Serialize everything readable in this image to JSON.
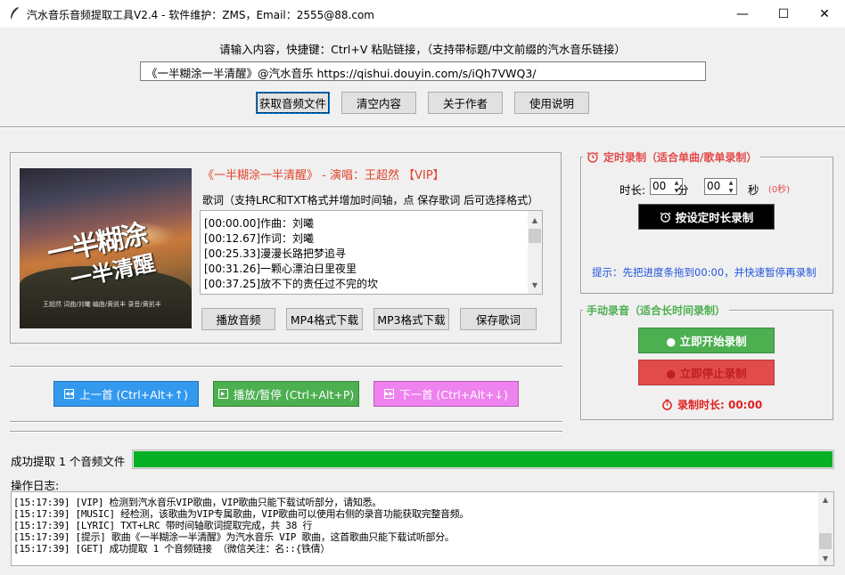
{
  "window": {
    "title": "汽水音乐音频提取工具V2.4 - 软件维护：ZMS，Email：2555@88.com",
    "minimize": "—",
    "maximize": "☐",
    "close": "✕"
  },
  "input": {
    "hint": "请输入内容，快捷键：Ctrl+V 粘贴链接，（支持带标题/中文前缀的汽水音乐链接）",
    "value": "《一半糊涂一半清醒》@汽水音乐 https://qishui.douyin.com/s/iQh7VWQ3/"
  },
  "top_buttons": {
    "fetch": "获取音频文件",
    "clear": "清空内容",
    "about": "关于作者",
    "help": "使用说明"
  },
  "song": {
    "title_line": "《一半糊涂一半清醒》 - 演唱：王超然 【VIP】",
    "cover_art_text": "一半糊涂一半清醒",
    "cover_credit": "王超然     词曲/刘曦   编曲/黄凯丰   录音/黄凯丰",
    "lyrics_label": "歌词（支持LRC和TXT格式并增加时间轴，点 保存歌词 后可选择格式）",
    "lyrics": [
      "[00:00.00]作曲：刘曦",
      "[00:12.67]作词：刘曦",
      "[00:25.33]漫漫长路把梦追寻",
      "[00:31.26]一颗心漂泊日里夜里",
      "[00:37.25]放不下的责任过不完的坎"
    ],
    "buttons": {
      "play": "播放音频",
      "mp4": "MP4格式下载",
      "mp3": "MP3格式下载",
      "save_lyrics": "保存歌词"
    }
  },
  "nav": {
    "prev": "上一首 (Ctrl+Alt+↑)",
    "play_pause": "播放/暂停 (Ctrl+Alt+P)",
    "next": "下一首 (Ctrl+Alt+↓)",
    "colors": {
      "prev": "#3399ee",
      "play": "#4caf50",
      "next": "#ee82ee"
    }
  },
  "timer_record": {
    "title": "定时录制（适合单曲/歌单录制）",
    "duration_label": "时长:",
    "minutes_value": "00",
    "minutes_unit": "分",
    "seconds_value": "00",
    "seconds_unit": "秒",
    "seconds_total": "(0秒)",
    "record_button": "按设定时长录制",
    "tip": "提示：先把进度条拖到00:00，并快速暂停再录制"
  },
  "manual_record": {
    "title": "手动录音（适合长时间录制）",
    "start_button": "● 立即开始录制",
    "stop_button": "● 立即停止录制",
    "duration_label": "录制时长: 00:00"
  },
  "status": {
    "text": "成功提取 1 个音频文件",
    "progress": 1.0,
    "progress_color": "#06b025"
  },
  "log": {
    "label": "操作日志:",
    "lines": [
      "[15:17:39] [VIP] 检测到汽水音乐VIP歌曲，VIP歌曲只能下载试听部分，请知悉。",
      "[15:17:39] [MUSIC] 经检测，该歌曲为VIP专属歌曲，VIP歌曲可以使用右侧的录音功能获取完整音频。",
      "[15:17:39] [LYRIC] TXT+LRC 带时间轴歌词提取完成，共 38 行",
      "[15:17:39] [提示] 歌曲《一半糊涂一半清醒》为汽水音乐 VIP 歌曲，这首歌曲只能下载试听部分。",
      "[15:17:39] [GET] 成功提取 1 个音频链接 （微信关注：名::{铁倩）"
    ]
  }
}
